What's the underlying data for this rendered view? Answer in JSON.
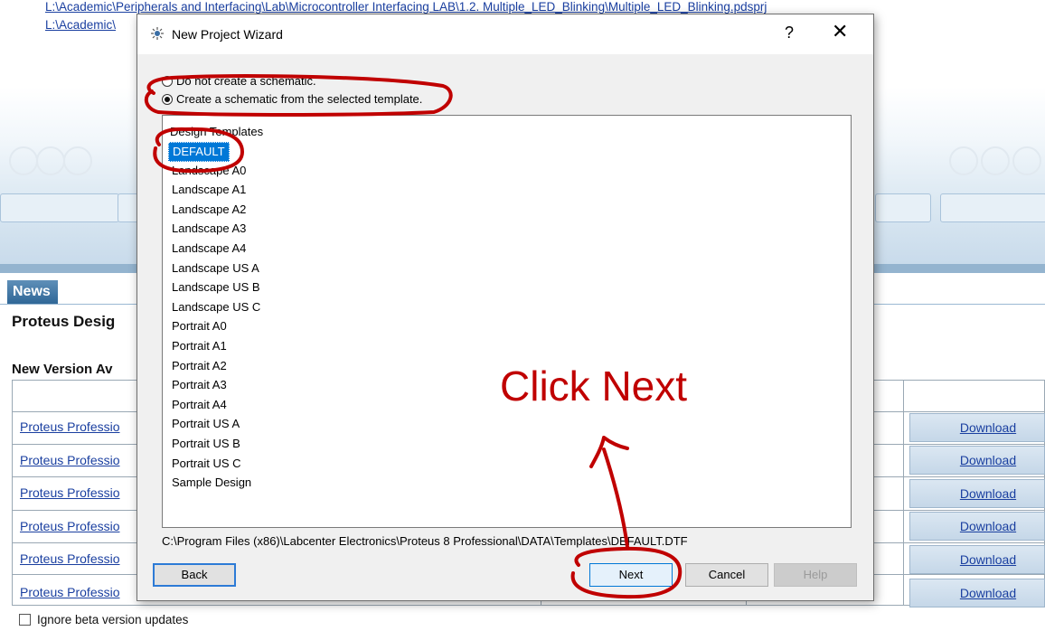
{
  "background": {
    "recent_projects": [
      "L:\\Academic\\Peripherals and Interfacing\\Lab\\Microcontroller Interfacing LAB\\1.2. Multiple_LED_Blinking\\Multiple_LED_Blinking.pdsprj",
      "L:\\Academic\\"
    ],
    "news_tab": "News",
    "proteus_heading": "Proteus Desig",
    "new_version_heading": "New Version Av",
    "product_links": [
      "Proteus Professio",
      "Proteus Professio",
      "Proteus Professio",
      "Proteus Professio",
      "Proteus Professio",
      "Proteus Professio"
    ],
    "download_label": "Download",
    "ignore_beta_label": "Ignore beta version updates"
  },
  "dialog": {
    "title": "New Project Wizard",
    "help_label": "?",
    "close_label": "✕",
    "options": {
      "no_schematic": "Do not create a schematic.",
      "from_template": "Create a schematic from the selected template."
    },
    "selected_option": "from_template",
    "templates_header": "Design Templates",
    "templates": [
      "DEFAULT",
      "Landscape A0",
      "Landscape A1",
      "Landscape A2",
      "Landscape A3",
      "Landscape A4",
      "Landscape US A",
      "Landscape US B",
      "Landscape US C",
      "Portrait A0",
      "Portrait A1",
      "Portrait A2",
      "Portrait A3",
      "Portrait A4",
      "Portrait US A",
      "Portrait US B",
      "Portrait US C",
      "Sample Design"
    ],
    "selected_template": "DEFAULT",
    "template_path": "C:\\Program Files (x86)\\Labcenter Electronics\\Proteus 8 Professional\\DATA\\Templates\\DEFAULT.DTF",
    "buttons": {
      "back": "Back",
      "next": "Next",
      "cancel": "Cancel",
      "help": "Help"
    }
  },
  "annotation": {
    "callout_text": "Click Next",
    "color": "#c00000"
  }
}
